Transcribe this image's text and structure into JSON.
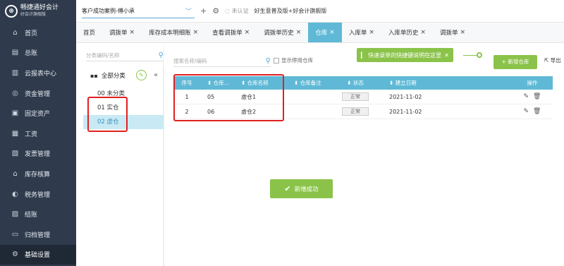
{
  "brand": {
    "name": "畅捷通好会计",
    "sub": "好会计旗舰版"
  },
  "sidebar": {
    "items": [
      {
        "label": "首页",
        "icon": "home-icon",
        "glyph": "⌂"
      },
      {
        "label": "总账",
        "icon": "ledger-icon",
        "glyph": "▤"
      },
      {
        "label": "云报表中心",
        "icon": "chart-icon",
        "glyph": "▥"
      },
      {
        "label": "资金管理",
        "icon": "money-icon",
        "glyph": "◎"
      },
      {
        "label": "固定资产",
        "icon": "asset-icon",
        "glyph": "▣"
      },
      {
        "label": "工资",
        "icon": "salary-icon",
        "glyph": "▦"
      },
      {
        "label": "发票管理",
        "icon": "invoice-icon",
        "glyph": "▧"
      },
      {
        "label": "库存核算",
        "icon": "inventory-icon",
        "glyph": "⌂"
      },
      {
        "label": "税务管理",
        "icon": "tax-icon",
        "glyph": "◐"
      },
      {
        "label": "结账",
        "icon": "close-book-icon",
        "glyph": "▨"
      },
      {
        "label": "归档管理",
        "icon": "archive-icon",
        "glyph": "▭"
      },
      {
        "label": "基础设置",
        "icon": "settings-icon",
        "glyph": "⚙"
      }
    ]
  },
  "topbar": {
    "company": "客户成功案例-傅小承",
    "add_glyph": "+",
    "settings_glyph": "⚙",
    "cert_text": "未认证",
    "edition_text": "好生意普及版+好会计旗舰版"
  },
  "tabs": [
    {
      "label": "首页",
      "closable": false
    },
    {
      "label": "调拨单",
      "closable": true
    },
    {
      "label": "库存成本明细账",
      "closable": true
    },
    {
      "label": "查看调拨单",
      "closable": true
    },
    {
      "label": "调拨单历史",
      "closable": true
    },
    {
      "label": "仓库",
      "closable": true,
      "active": true
    },
    {
      "label": "入库单",
      "closable": true
    },
    {
      "label": "入库单历史",
      "closable": true
    },
    {
      "label": "调拨单",
      "closable": true
    }
  ],
  "category": {
    "search_placeholder": "分类编码/名称",
    "all_label": "全部分类",
    "items": [
      "00 未分类",
      "01 实仓",
      "02 虚仓"
    ],
    "selected_index": 2
  },
  "toolbar": {
    "search_placeholder": "搜索名称/编码",
    "show_disabled": "显示停用仓库",
    "tip": "快速录单的快捷键说明在这里",
    "add_button": "+ 新增仓库",
    "export_button": "导出"
  },
  "table": {
    "headers": [
      "序号",
      "仓库...",
      "仓库名称",
      "仓库备注",
      "状态",
      "建立日期",
      "操作"
    ],
    "rows": [
      {
        "no": "1",
        "code": "05",
        "name": "虚仓1",
        "remark": "",
        "status": "正常",
        "date": "2021-11-02"
      },
      {
        "no": "2",
        "code": "06",
        "name": "虚仓2",
        "remark": "",
        "status": "正常",
        "date": "2021-11-02"
      }
    ]
  },
  "toast": "新增成功",
  "colors": {
    "sidebar": "#2f3b4c",
    "accent": "#5fb9d6",
    "green": "#8bc34a",
    "highlight": "#e02020"
  }
}
